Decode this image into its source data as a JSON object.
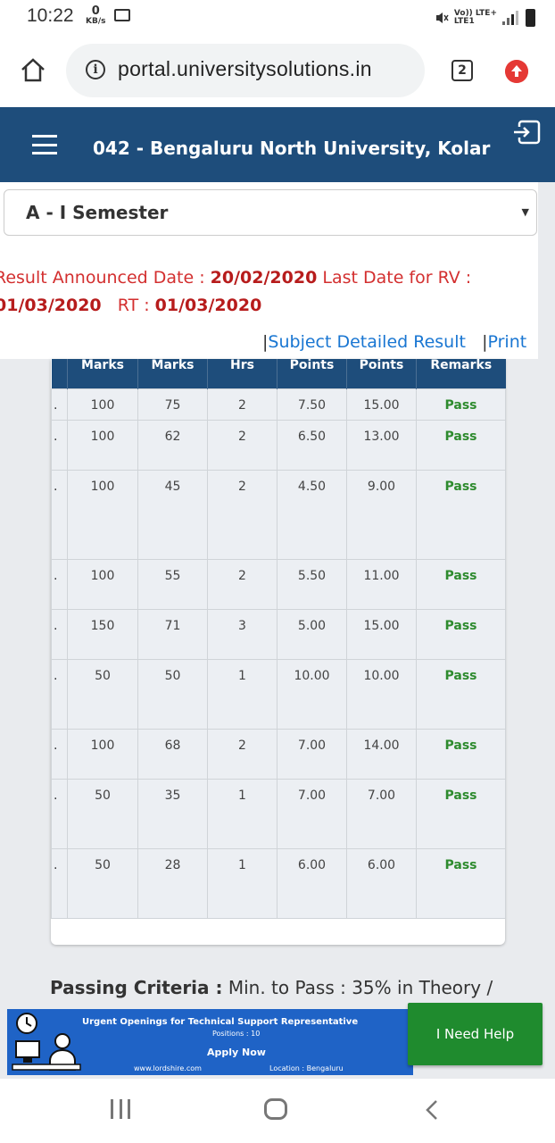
{
  "status_bar": {
    "time": "10:22",
    "data_rate_value": "0",
    "data_rate_unit": "KB/s",
    "network_line1": "Vo)) LTE+",
    "network_line2": "LTE1"
  },
  "browser": {
    "url": "portal.universitysolutions.in",
    "tab_count": "2"
  },
  "header": {
    "title": "042 - Bengaluru North University, Kolar"
  },
  "semester_select": {
    "selected": "A - I Semester"
  },
  "announcement": {
    "label1": "Result Announced Date : ",
    "date1": "20/02/2020",
    "label2": " Last Date for RV : ",
    "date2": "01/03/2020",
    "label3": "RT : ",
    "date3": "01/03/2020"
  },
  "links": {
    "subject_detailed": "Subject Detailed Result",
    "print": "Print"
  },
  "table": {
    "columns": [
      "",
      "Marks",
      "Marks",
      "Hrs",
      "Points",
      "Points",
      "Remarks"
    ],
    "rows": [
      {
        "max": "100",
        "obt": "75",
        "hrs": "2",
        "gp": "7.50",
        "cp": "15.00",
        "remark": "Pass",
        "h": 35
      },
      {
        "max": "100",
        "obt": "62",
        "hrs": "2",
        "gp": "6.50",
        "cp": "13.00",
        "remark": "Pass",
        "h": 56
      },
      {
        "max": "100",
        "obt": "45",
        "hrs": "2",
        "gp": "4.50",
        "cp": "9.00",
        "remark": "Pass",
        "h": 100
      },
      {
        "max": "100",
        "obt": "55",
        "hrs": "2",
        "gp": "5.50",
        "cp": "11.00",
        "remark": "Pass",
        "h": 56
      },
      {
        "max": "150",
        "obt": "71",
        "hrs": "3",
        "gp": "5.00",
        "cp": "15.00",
        "remark": "Pass",
        "h": 56
      },
      {
        "max": "50",
        "obt": "50",
        "hrs": "1",
        "gp": "10.00",
        "cp": "10.00",
        "remark": "Pass",
        "h": 78
      },
      {
        "max": "100",
        "obt": "68",
        "hrs": "2",
        "gp": "7.00",
        "cp": "14.00",
        "remark": "Pass",
        "h": 56
      },
      {
        "max": "50",
        "obt": "35",
        "hrs": "1",
        "gp": "7.00",
        "cp": "7.00",
        "remark": "Pass",
        "h": 78
      },
      {
        "max": "50",
        "obt": "28",
        "hrs": "1",
        "gp": "6.00",
        "cp": "6.00",
        "remark": "Pass",
        "h": 78
      }
    ]
  },
  "criteria": {
    "label": "Passing Criteria :",
    "text": " Min. to Pass : 35% in Theory /"
  },
  "ad": {
    "headline": "Urgent Openings for Technical Support Representative",
    "positions": "Positions : 10",
    "cta": "Apply Now",
    "website": "www.lordshire.com",
    "location": "Location : Bengaluru"
  },
  "help_button": {
    "label": "I Need Help"
  },
  "colors": {
    "header_bg": "#1e4d7b",
    "accent_red": "#d32f2f",
    "pass_green": "#2e8b2e",
    "link_blue": "#1976d2",
    "help_green": "#1f8b2e"
  }
}
